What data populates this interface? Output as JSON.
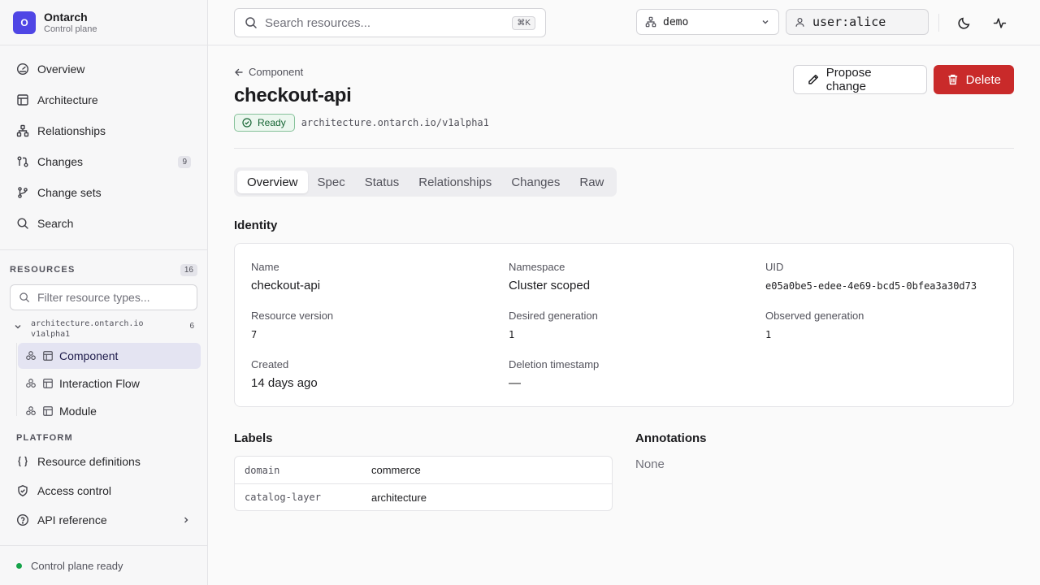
{
  "brand": {
    "logo_letter": "O",
    "name": "Ontarch",
    "subtitle": "Control plane",
    "color": "#4f46e5"
  },
  "nav": {
    "overview": "Overview",
    "architecture": "Architecture",
    "relationships": "Relationships",
    "changes": "Changes",
    "changes_count": "9",
    "change_sets": "Change sets",
    "search": "Search"
  },
  "resources": {
    "title": "RESOURCES",
    "count": "16",
    "filter_placeholder": "Filter resource types...",
    "group_line1": "architecture.ontarch.io",
    "group_line2": "v1alpha1",
    "group_count": "6",
    "items": [
      "Component",
      "Interaction Flow",
      "Module"
    ]
  },
  "platform": {
    "title": "PLATFORM",
    "resource_definitions": "Resource definitions",
    "access_control": "Access control",
    "api_reference": "API reference"
  },
  "footer": {
    "status": "Control plane ready",
    "status_color": "#16a34a"
  },
  "topbar": {
    "search_placeholder": "Search resources...",
    "search_shortcut": "⌘K",
    "namespace": "demo",
    "user": "user:alice"
  },
  "page": {
    "back_label": "Component",
    "title": "checkout-api",
    "status": "Ready",
    "api_version": "architecture.ontarch.io/v1alpha1",
    "propose_label": "Propose change",
    "delete_label": "Delete",
    "delete_color": "#c92a2a"
  },
  "tabs": [
    "Overview",
    "Spec",
    "Status",
    "Relationships",
    "Changes",
    "Raw"
  ],
  "identity": {
    "heading": "Identity",
    "name_label": "Name",
    "name_value": "checkout-api",
    "namespace_label": "Namespace",
    "namespace_value": "Cluster scoped",
    "uid_label": "UID",
    "uid_value": "e05a0be5-edee-4e69-bcd5-0bfea3a30d73",
    "resource_version_label": "Resource version",
    "resource_version_value": "7",
    "desired_generation_label": "Desired generation",
    "desired_generation_value": "1",
    "observed_generation_label": "Observed generation",
    "observed_generation_value": "1",
    "created_label": "Created",
    "created_value": "14 days ago",
    "deletion_label": "Deletion timestamp",
    "deletion_value": "—"
  },
  "labels": {
    "heading": "Labels",
    "rows": [
      {
        "key": "domain",
        "value": "commerce"
      },
      {
        "key": "catalog-layer",
        "value": "architecture"
      }
    ]
  },
  "annotations": {
    "heading": "Annotations",
    "empty": "None"
  }
}
